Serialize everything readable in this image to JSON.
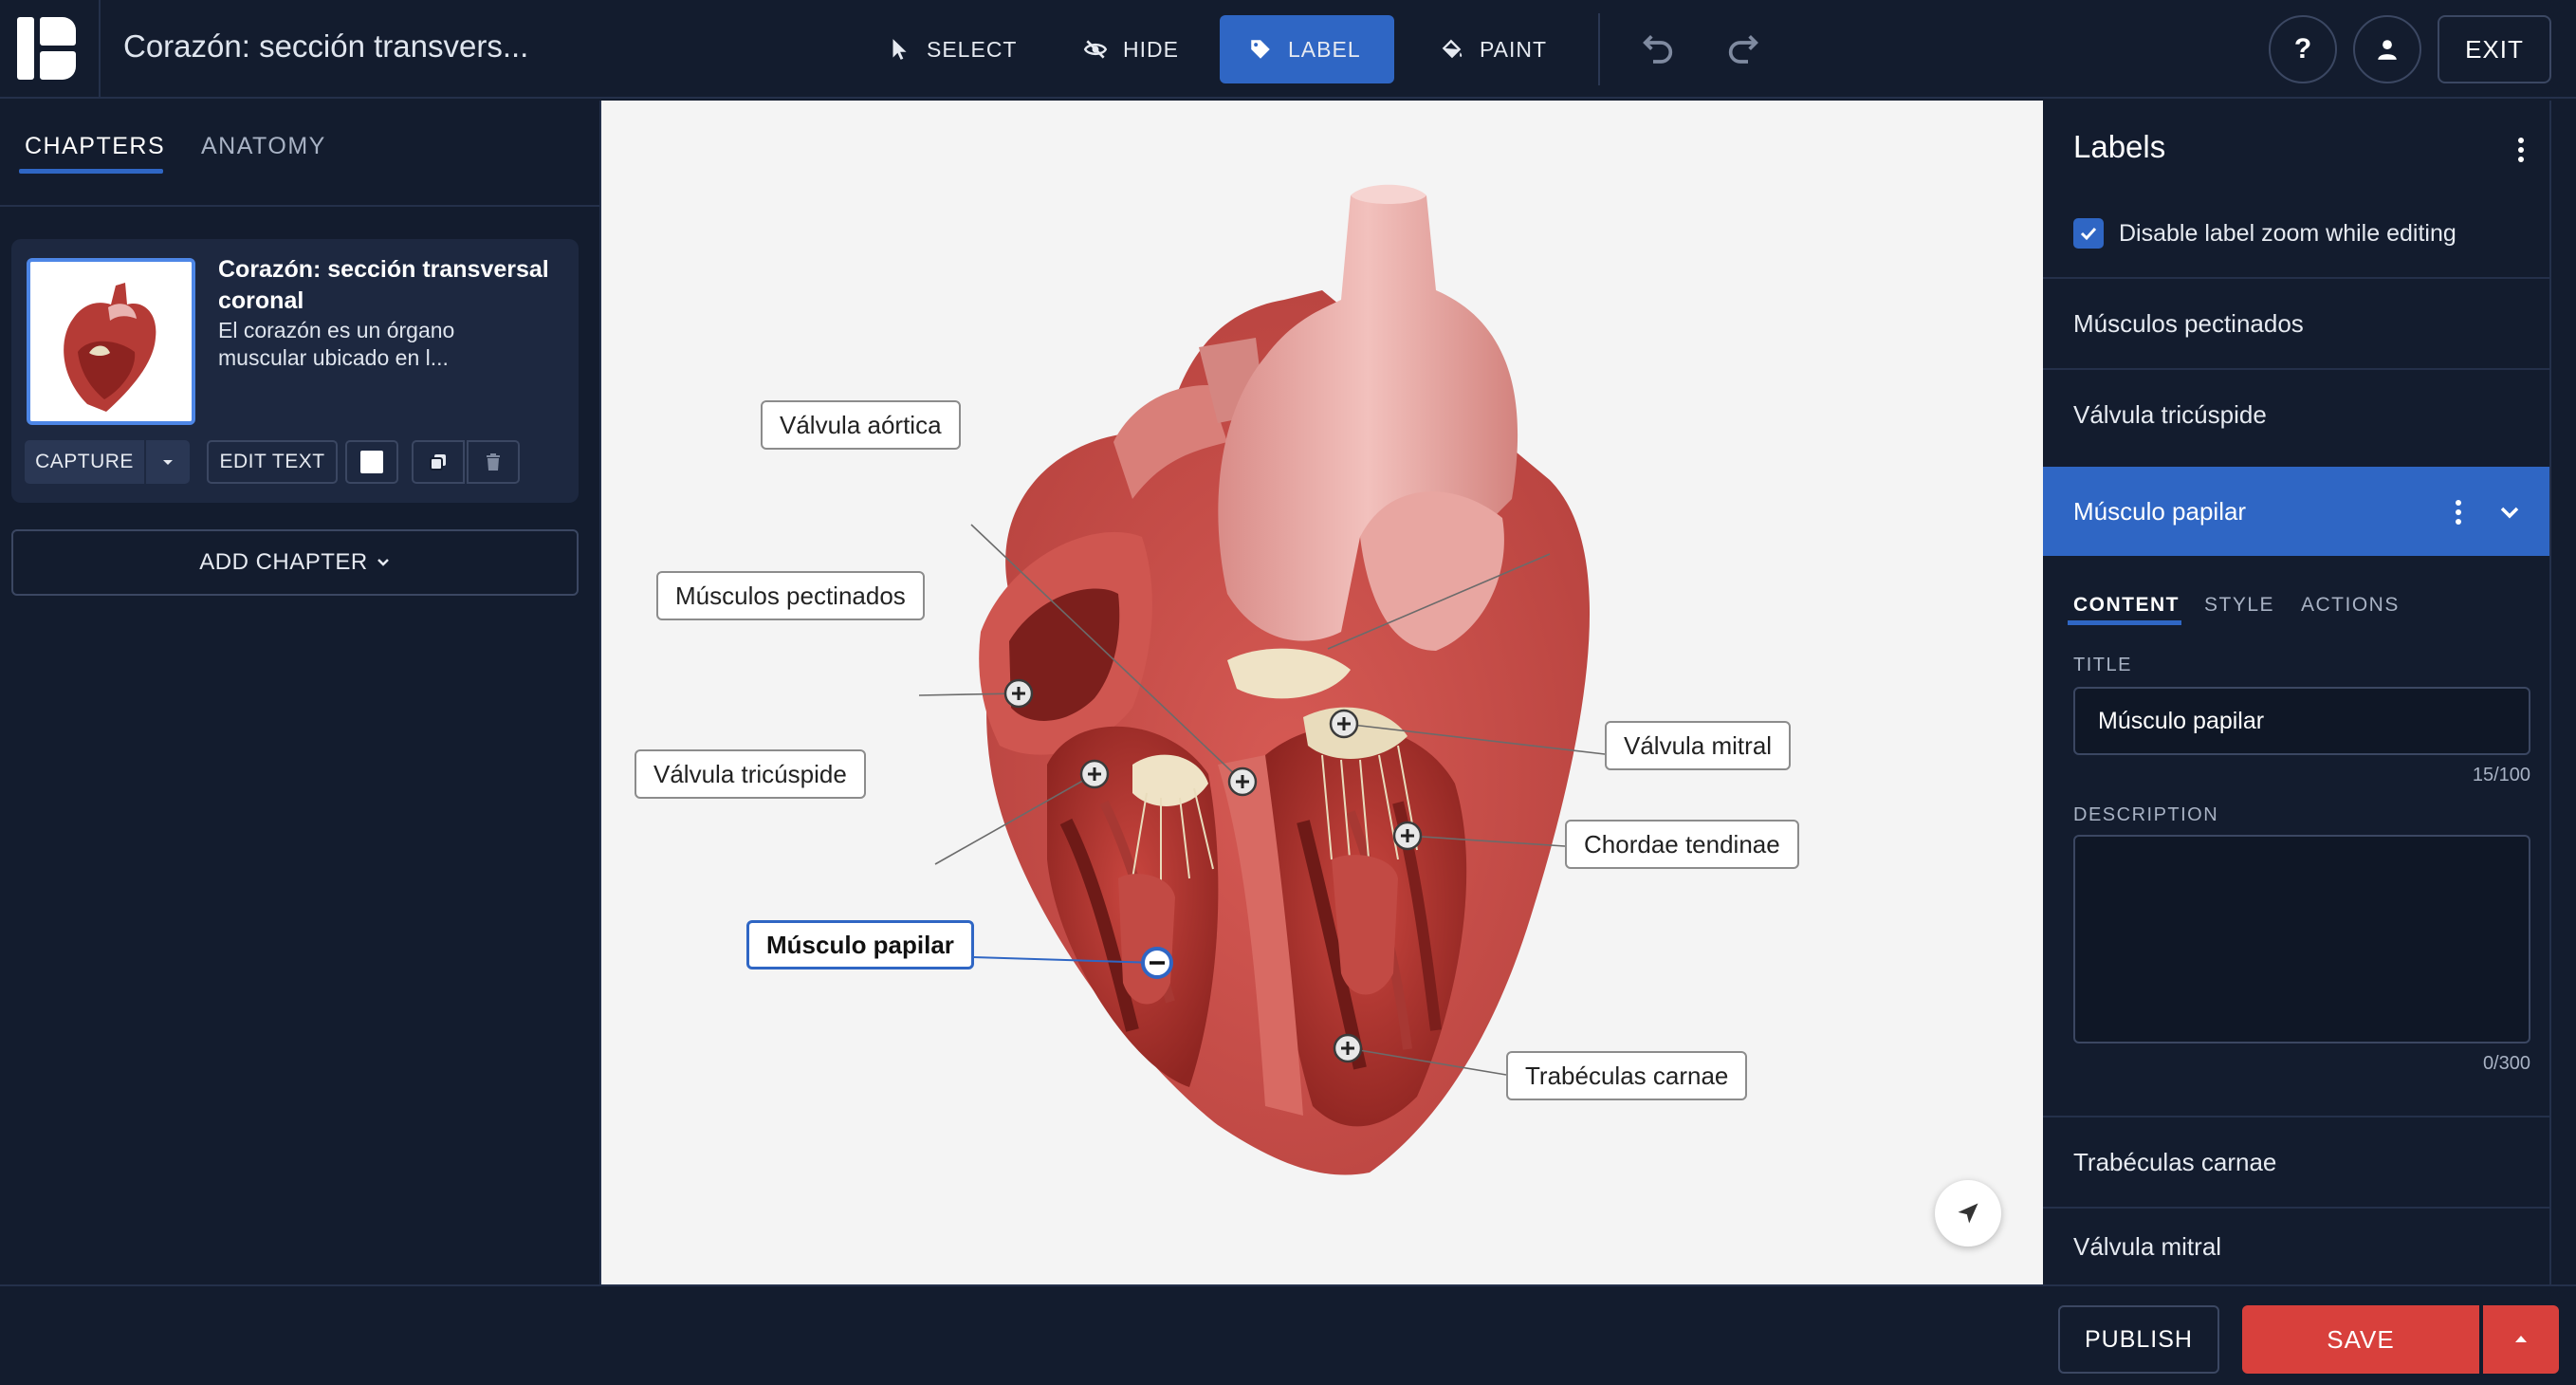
{
  "header": {
    "doc_title": "Corazón: sección transvers...",
    "tools": {
      "select": "SELECT",
      "hide": "HIDE",
      "label": "LABEL",
      "paint": "PAINT"
    },
    "help": "?",
    "exit": "EXIT",
    "active_tool": "label"
  },
  "left_panel": {
    "tabs": [
      "CHAPTERS",
      "ANATOMY"
    ],
    "active_tab": "CHAPTERS",
    "chapter": {
      "title": "Corazón: sección transversal coronal",
      "description": "El corazón es un órgano muscular ubicado en l...",
      "capture_label": "CAPTURE",
      "edit_text_label": "EDIT TEXT",
      "color_swatch": "#ffffff"
    },
    "add_chapter": "ADD CHAPTER"
  },
  "viewport": {
    "labels": [
      {
        "text": "Válvula aórtica",
        "selected": false
      },
      {
        "text": "Músculos pectinados",
        "selected": false
      },
      {
        "text": "Válvula tricúspide",
        "selected": false
      },
      {
        "text": "Músculo papilar",
        "selected": true
      },
      {
        "text": "Válvula mitral",
        "selected": false
      },
      {
        "text": "Chordae tendinae",
        "selected": false
      },
      {
        "text": "Trabéculas carnae",
        "selected": false
      }
    ]
  },
  "right_panel": {
    "heading": "Labels",
    "disable_zoom_label": "Disable label zoom while editing",
    "disable_zoom_checked": true,
    "items_above": [
      "Músculos pectinados",
      "Válvula tricúspide"
    ],
    "selected_item": "Músculo papilar",
    "editor_tabs": [
      "CONTENT",
      "STYLE",
      "ACTIONS"
    ],
    "active_editor_tab": "CONTENT",
    "title_field_label": "TITLE",
    "title_value": "Músculo papilar",
    "title_counter": "15/100",
    "description_field_label": "DESCRIPTION",
    "description_value": "",
    "description_counter": "0/300",
    "items_below": [
      "Trabéculas carnae",
      "Válvula mitral"
    ]
  },
  "footer": {
    "publish": "PUBLISH",
    "save": "SAVE"
  },
  "colors": {
    "background": "#131c2e",
    "accent": "#2f66c4",
    "save": "#d8403c",
    "viewport_bg": "#f4f4f4"
  }
}
